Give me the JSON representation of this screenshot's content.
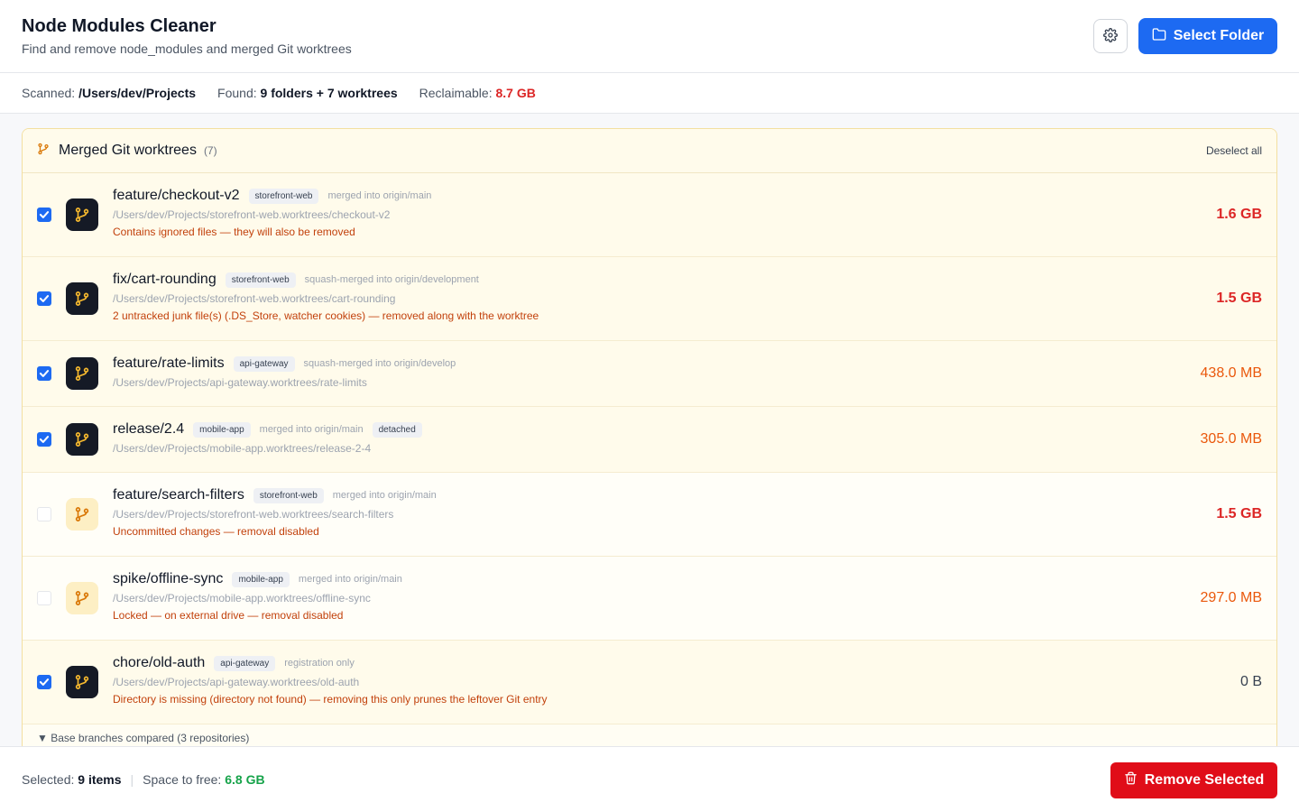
{
  "header": {
    "title": "Node Modules Cleaner",
    "subtitle": "Find and remove node_modules and merged Git worktrees",
    "settings_icon": "gear-icon",
    "select_folder_label": "Select Folder",
    "folder_icon": "folder-icon",
    "accent": "#1d6af2"
  },
  "stats": {
    "scanned_label": "Scanned:",
    "scanned_value": "/Users/dev/Projects",
    "found_label": "Found:",
    "found_value": "9 folders + 7 worktrees",
    "reclaimable_label": "Reclaimable:",
    "reclaimable_value": "8.7 GB"
  },
  "panel": {
    "title": "Merged Git worktrees",
    "count": "(7)",
    "deselect_label": "Deselect all",
    "icon": "git-branch-icon",
    "rows": [
      {
        "checked": true,
        "branch": "feature/checkout-v2",
        "tag": "storefront-web",
        "meta": "merged into origin/main",
        "path": "/Users/dev/Projects/storefront-web.worktrees/checkout-v2",
        "warning": "Contains ignored files — they will also be removed",
        "size": "1.6 GB"
      },
      {
        "checked": true,
        "branch": "fix/cart-rounding",
        "tag": "storefront-web",
        "meta": "squash-merged into origin/development",
        "path": "/Users/dev/Projects/storefront-web.worktrees/cart-rounding",
        "warning": "2 untracked junk file(s) (.DS_Store, watcher cookies) — removed along with the worktree",
        "size": "1.5 GB"
      },
      {
        "checked": true,
        "branch": "feature/rate-limits",
        "tag": "api-gateway",
        "meta": "squash-merged into origin/develop",
        "path": "/Users/dev/Projects/api-gateway.worktrees/rate-limits",
        "size": "438.0 MB"
      },
      {
        "checked": true,
        "branch": "release/2.4",
        "tag": "mobile-app",
        "meta": "merged into origin/main",
        "tag2": "detached",
        "path": "/Users/dev/Projects/mobile-app.worktrees/release-2-4",
        "size": "305.0 MB"
      },
      {
        "checked": false,
        "branch": "feature/search-filters",
        "tag": "storefront-web",
        "meta": "merged into origin/main",
        "path": "/Users/dev/Projects/storefront-web.worktrees/search-filters",
        "warning": "Uncommitted changes — removal disabled",
        "size": "1.5 GB"
      },
      {
        "checked": false,
        "branch": "spike/offline-sync",
        "tag": "mobile-app",
        "meta": "merged into origin/main",
        "path": "/Users/dev/Projects/mobile-app.worktrees/offline-sync",
        "warning": "Locked — on external drive — removal disabled",
        "size": "297.0 MB"
      },
      {
        "checked": true,
        "branch": "chore/old-auth",
        "tag": "api-gateway",
        "meta": "registration only",
        "path": "/Users/dev/Projects/api-gateway.worktrees/old-auth",
        "warning": "Directory is missing (directory not found) — removing this only prunes the leftover Git entry",
        "size": "0 B"
      }
    ],
    "base_branches_label": "▼ Base branches compared (3 repositories)"
  },
  "footer": {
    "selected_label": "Selected:",
    "selected_value": "9 items",
    "space_label": "Space to free:",
    "space_value": "6.8 GB",
    "remove_label": "Remove Selected",
    "trash_icon": "trash-icon",
    "danger": "#e00d18"
  }
}
